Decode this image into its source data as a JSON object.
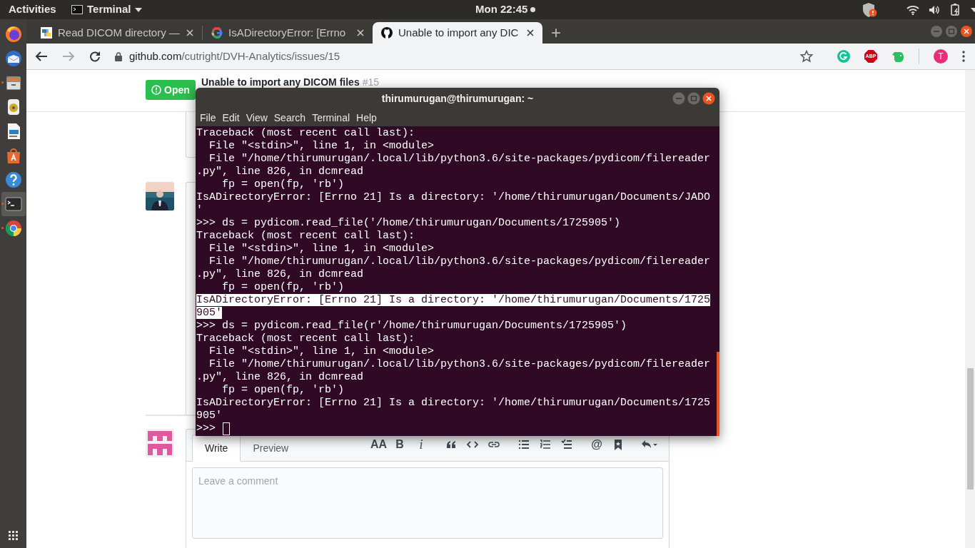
{
  "top_bar": {
    "activities": "Activities",
    "app_menu": "Terminal",
    "clock": "Mon 22:45"
  },
  "dock": {
    "items": [
      {
        "kind": "firefox",
        "running": false,
        "selected": false
      },
      {
        "kind": "mail",
        "running": false,
        "selected": false
      },
      {
        "kind": "files",
        "running": true,
        "selected": false
      },
      {
        "kind": "music",
        "running": false,
        "selected": false
      },
      {
        "kind": "writer",
        "running": false,
        "selected": false
      },
      {
        "kind": "store",
        "running": false,
        "selected": false
      },
      {
        "kind": "help",
        "running": false,
        "selected": false
      },
      {
        "kind": "terminal",
        "running": true,
        "selected": true
      },
      {
        "kind": "chrome",
        "running": true,
        "selected": false
      }
    ]
  },
  "browser": {
    "tabs": [
      {
        "title": "Read DICOM directory —",
        "kind": "python",
        "selected": false
      },
      {
        "title": "IsADirectoryError: [Errno",
        "kind": "google",
        "selected": false
      },
      {
        "title": "Unable to import any DIC",
        "kind": "github",
        "selected": true
      }
    ],
    "new_tab": "+",
    "url_host": "github.com",
    "url_path": "/cutright/DVH-Analytics/issues/15",
    "profile_initial": "T",
    "extensions": [
      {
        "kind": "grammarly"
      },
      {
        "kind": "adblock",
        "label": "ABP"
      },
      {
        "kind": "evernote"
      }
    ]
  },
  "issue": {
    "state": "Open",
    "title": "Unable to import any DICOM files",
    "number": "#15"
  },
  "terminal": {
    "title": "thirumurugan@thirumurugan: ~",
    "menu": [
      "File",
      "Edit",
      "View",
      "Search",
      "Terminal",
      "Help"
    ],
    "lines": [
      {
        "text": "Traceback (most recent call last):",
        "selected": false
      },
      {
        "text": "  File \"<stdin>\", line 1, in <module>",
        "selected": false
      },
      {
        "text": "  File \"/home/thirumurugan/.local/lib/python3.6/site-packages/pydicom/filereader",
        "selected": false
      },
      {
        "text": ".py\", line 826, in dcmread",
        "selected": false
      },
      {
        "text": "    fp = open(fp, 'rb')",
        "selected": false
      },
      {
        "text": "IsADirectoryError: [Errno 21] Is a directory: '/home/thirumurugan/Documents/JADO",
        "selected": false
      },
      {
        "text": "'",
        "selected": false
      },
      {
        "text": ">>> ds = pydicom.read_file('/home/thirumurugan/Documents/1725905')",
        "selected": false
      },
      {
        "text": "Traceback (most recent call last):",
        "selected": false
      },
      {
        "text": "  File \"<stdin>\", line 1, in <module>",
        "selected": false
      },
      {
        "text": "  File \"/home/thirumurugan/.local/lib/python3.6/site-packages/pydicom/filereader",
        "selected": false
      },
      {
        "text": ".py\", line 826, in dcmread",
        "selected": false
      },
      {
        "text": "    fp = open(fp, 'rb')",
        "selected": false
      },
      {
        "text": "IsADirectoryError: [Errno 21] Is a directory: '/home/thirumurugan/Documents/1725",
        "selected": true
      },
      {
        "text": "905'",
        "selected": true
      },
      {
        "text": ">>> ds = pydicom.read_file(r'/home/thirumurugan/Documents/1725905')",
        "selected": false
      },
      {
        "text": "Traceback (most recent call last):",
        "selected": false
      },
      {
        "text": "  File \"<stdin>\", line 1, in <module>",
        "selected": false
      },
      {
        "text": "  File \"/home/thirumurugan/.local/lib/python3.6/site-packages/pydicom/filereader",
        "selected": false
      },
      {
        "text": ".py\", line 826, in dcmread",
        "selected": false
      },
      {
        "text": "    fp = open(fp, 'rb')",
        "selected": false
      },
      {
        "text": "IsADirectoryError: [Errno 21] Is a directory: '/home/thirumurugan/Documents/1725",
        "selected": false
      },
      {
        "text": "905'",
        "selected": false
      }
    ],
    "prompt": ">>>"
  },
  "comment_form": {
    "tabs": [
      {
        "label": "Write",
        "selected": true
      },
      {
        "label": "Preview",
        "selected": false
      }
    ],
    "toolbar": [
      {
        "kind": "glyph",
        "glyph": "AA"
      },
      {
        "kind": "glyph",
        "glyph": "B"
      },
      {
        "kind": "italic",
        "glyph": "i"
      },
      {
        "kind": "quote"
      },
      {
        "kind": "code"
      },
      {
        "kind": "link"
      },
      {
        "kind": "bullets"
      },
      {
        "kind": "numbers"
      },
      {
        "kind": "tasks"
      },
      {
        "kind": "glyph",
        "glyph": "@"
      },
      {
        "kind": "bookmark"
      },
      {
        "kind": "reply"
      }
    ],
    "placeholder": "Leave a comment"
  }
}
